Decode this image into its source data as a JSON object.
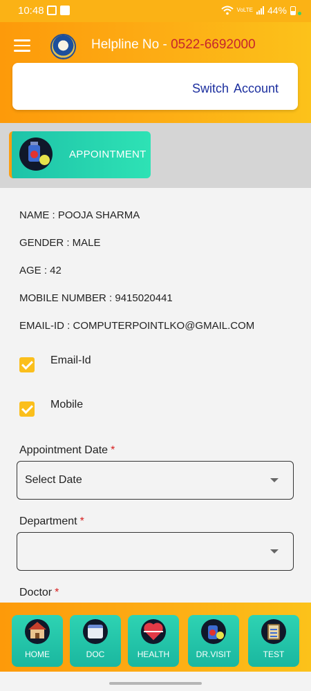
{
  "status_bar": {
    "time": "10:48",
    "network_label": "VoLTE",
    "battery": "44%"
  },
  "header": {
    "helpline_label": "Helpline No - ",
    "helpline_number": "0522-6692000",
    "switch_account": "Switch  Account"
  },
  "tab": {
    "label": "APPOINTMENT"
  },
  "patient": {
    "name": "NAME : POOJA SHARMA",
    "gender": "GENDER :  MALE",
    "age": "AGE :  42",
    "mobile": "MOBILE NUMBER :  9415020441",
    "email": "EMAIL-ID :  COMPUTERPOINTLKO@GMAIL.COM"
  },
  "notify": {
    "email_label": "Email-Id",
    "email_checked": true,
    "mobile_label": "Mobile",
    "mobile_checked": true
  },
  "form": {
    "appointment_date_label": "Appointment Date",
    "appointment_date_value": "Select Date",
    "department_label": "Department",
    "department_value": "",
    "doctor_label": "Doctor",
    "required_mark": "*"
  },
  "bottom_nav": {
    "items": [
      {
        "label": "HOME",
        "icon": "home-icon"
      },
      {
        "label": "DOC",
        "icon": "calendar-icon"
      },
      {
        "label": "HEALTH",
        "icon": "heart-icon"
      },
      {
        "label": "DR.VISIT",
        "icon": "medicine-icon"
      },
      {
        "label": "TEST",
        "icon": "clipboard-icon"
      }
    ]
  },
  "colors": {
    "header_orange": "#fd9a0a",
    "accent_yellow": "#fbbf1c",
    "teal": "#1ec3a8",
    "link_blue": "#1b2e9e",
    "helpline_red": "#c6252d"
  }
}
